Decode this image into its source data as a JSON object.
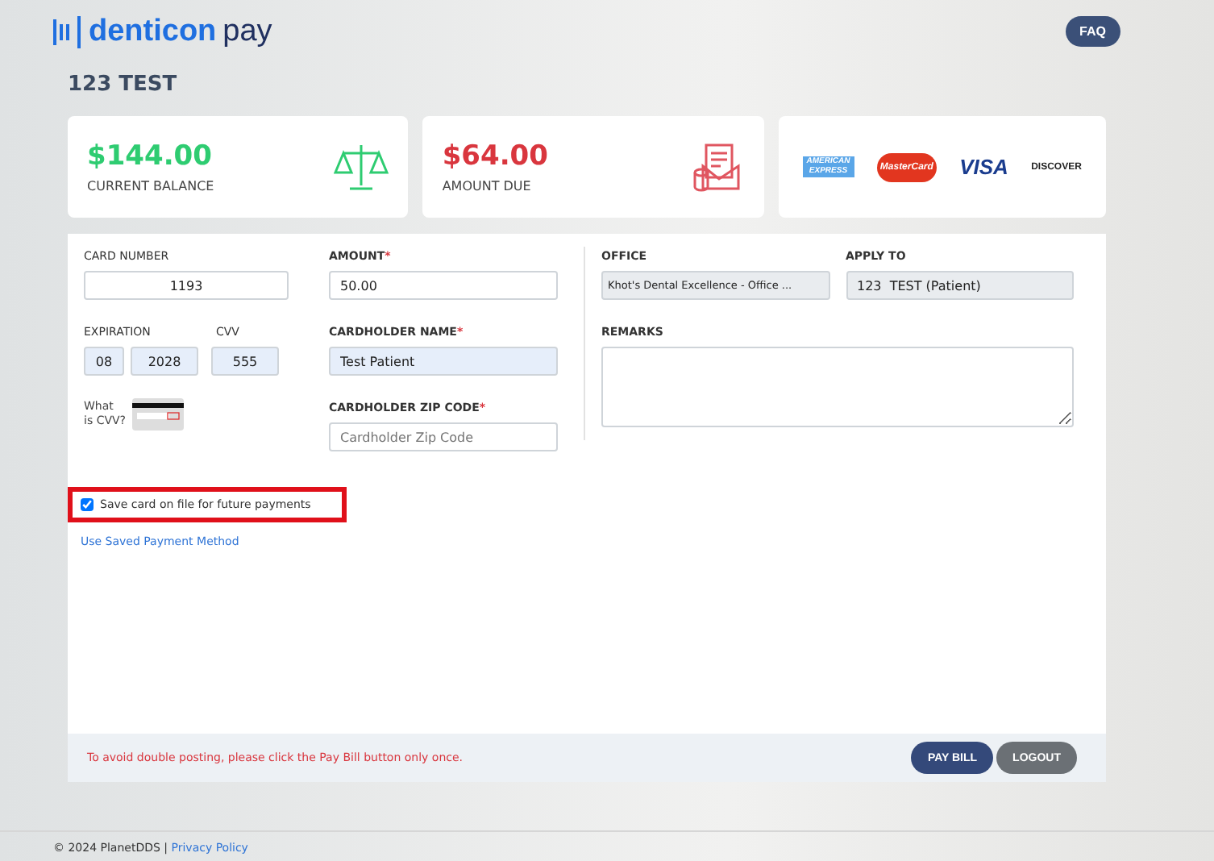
{
  "header": {
    "logo_word": "denticon",
    "logo_suffix": "pay",
    "faq_button": "FAQ"
  },
  "patient_name": "123 TEST",
  "summary_cards": [
    {
      "kind": "balance",
      "amount": "$144.00",
      "label": "CURRENT BALANCE",
      "color": "#2ecc71"
    },
    {
      "kind": "due",
      "amount": "$64.00",
      "label": "AMOUNT DUE",
      "color": "#d9363e"
    }
  ],
  "card_brands": [
    "AMERICAN EXPRESS",
    "MasterCard",
    "VISA",
    "DISCOVER"
  ],
  "form": {
    "card_number": {
      "label": "CARD NUMBER",
      "value": "1193"
    },
    "expiration": {
      "label": "EXPIRATION",
      "month": "08",
      "year": "2028"
    },
    "cvv": {
      "label": "CVV",
      "value": "555"
    },
    "cvv_help": "What is CVV?",
    "amount": {
      "label": "AMOUNT",
      "required_mark": "*",
      "value": "50.00"
    },
    "cardholder_name": {
      "label": "CARDHOLDER NAME",
      "required_mark": "*",
      "value": "Test Patient"
    },
    "zip_code": {
      "label": "CARDHOLDER ZIP CODE",
      "required_mark": "*",
      "placeholder": "Cardholder Zip Code"
    },
    "office": {
      "label": "OFFICE",
      "value": "Khot's Dental Excellence - Office ..."
    },
    "apply_to": {
      "label": "APPLY TO",
      "value": "123  TEST (Patient)"
    },
    "remarks": {
      "label": "REMARKS"
    },
    "save_card": {
      "label": "Save card on file for future payments",
      "checked": true,
      "highlighted": true
    },
    "saved_method_link": "Use Saved Payment Method"
  },
  "action_bar": {
    "warning": "To avoid double posting, please click the Pay Bill button only once.",
    "pay_button": "PAY BILL",
    "logout_button": "LOGOUT"
  },
  "footer": {
    "copyright": "© 2024 PlanetDDS |",
    "privacy_link": "Privacy Policy"
  }
}
